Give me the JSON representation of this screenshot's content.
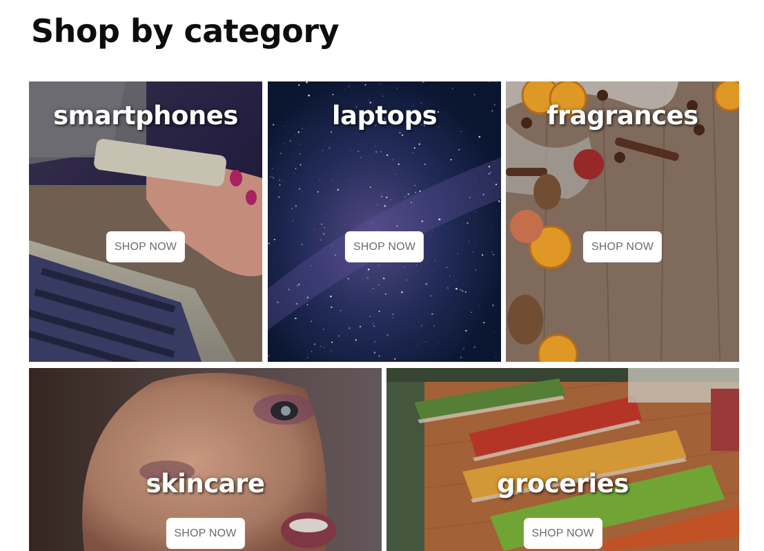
{
  "page": {
    "title": "Shop by category"
  },
  "categories": [
    {
      "name": "smartphones",
      "cta": "SHOP NOW"
    },
    {
      "name": "laptops",
      "cta": "SHOP NOW"
    },
    {
      "name": "fragrances",
      "cta": "SHOP NOW"
    },
    {
      "name": "skincare",
      "cta": "SHOP NOW"
    },
    {
      "name": "groceries",
      "cta": "SHOP NOW"
    }
  ]
}
